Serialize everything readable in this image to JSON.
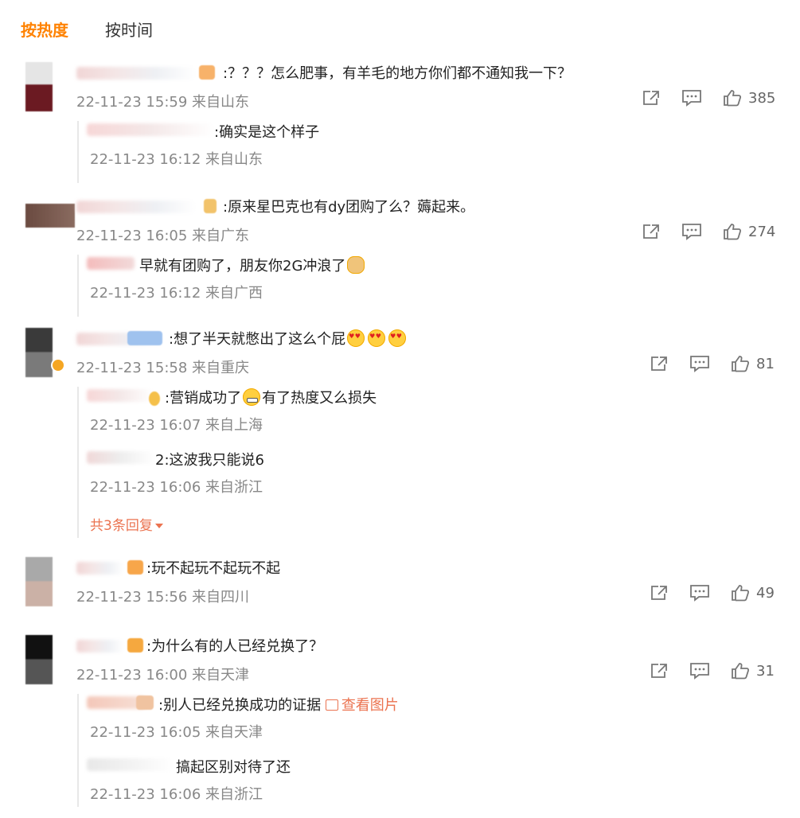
{
  "tabs": [
    {
      "label": "按热度",
      "active": true
    },
    {
      "label": "按时间",
      "active": false
    }
  ],
  "colors": {
    "accent": "#ff8200",
    "link": "#eb7350",
    "meta": "#888888"
  },
  "comments": [
    {
      "text": ":？？？怎么肥事，有羊毛的地方你们都不通知我一下？",
      "meta": "22-11-23 15:59 来自山东",
      "likes": "385",
      "replies": [
        {
          "text": ":确实是这个样子",
          "meta": "22-11-23 16:12 来自山东"
        }
      ]
    },
    {
      "text": ":原来星巴克也有dy团购了么？薅起来。",
      "meta": "22-11-23 16:05 来自广东",
      "likes": "274",
      "replies": [
        {
          "text": "早就有团购了，朋友你2G冲浪了",
          "meta": "22-11-23 16:12 来自广西"
        }
      ]
    },
    {
      "text": ":想了半天就憋出了这么个屁",
      "meta": "22-11-23 15:58 来自重庆",
      "likes": "81",
      "replies": [
        {
          "text_before": ":营销成功了",
          "text_after": "有了热度又么损失",
          "meta": "22-11-23 16:07 来自上海"
        },
        {
          "text": "2:这波我只能说6",
          "meta": "22-11-23 16:06 来自浙江"
        }
      ],
      "more_replies": "共3条回复"
    },
    {
      "text": ":玩不起玩不起玩不起",
      "meta": "22-11-23 15:56 来自四川",
      "likes": "49"
    },
    {
      "text": ":为什么有的人已经兑换了？",
      "meta": "22-11-23 16:00 来自天津",
      "likes": "31",
      "replies": [
        {
          "text": ":别人已经兑换成功的证据",
          "link": "查看图片",
          "meta": "22-11-23 16:05 来自天津"
        },
        {
          "text": "搞起区别对待了还",
          "meta": "22-11-23 16:06 来自浙江"
        }
      ]
    }
  ],
  "icons": {
    "share": "share-icon",
    "comment": "comment-icon",
    "like": "thumbs-up-icon",
    "image": "image-icon",
    "dropdown": "caret-down-icon"
  }
}
